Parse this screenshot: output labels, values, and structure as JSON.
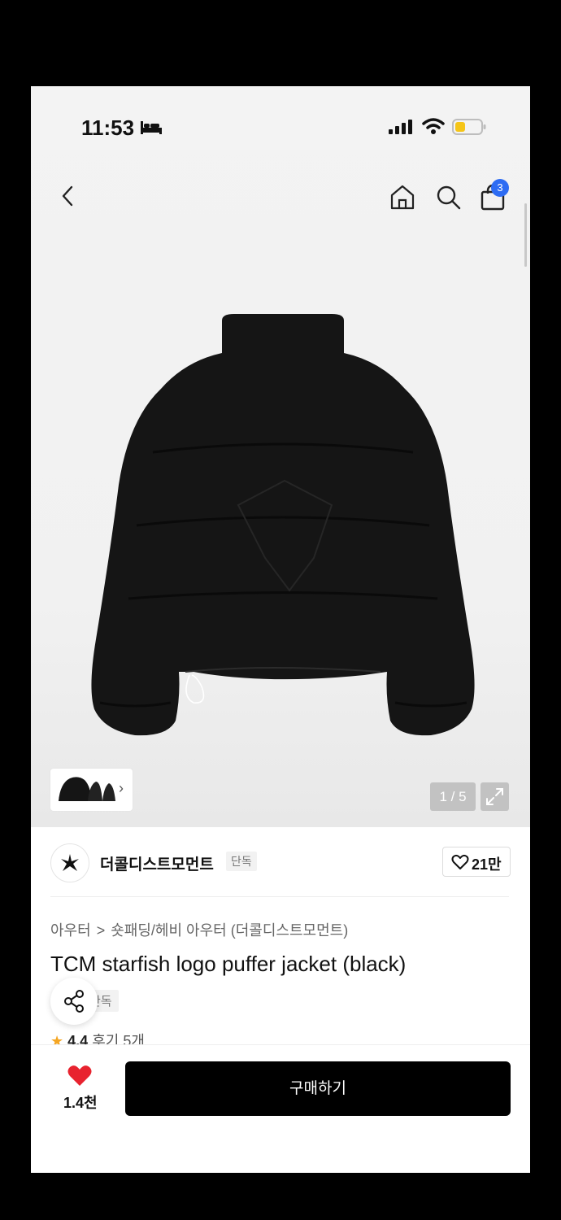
{
  "status_bar": {
    "time": "11:53"
  },
  "header": {
    "cart_count": "3"
  },
  "gallery": {
    "page_indicator": "1 / 5"
  },
  "brand": {
    "name": "더콜디스트모먼트",
    "badge": "단독",
    "likes": "21만"
  },
  "breadcrumb": {
    "category": "아우터",
    "separator": ">",
    "subcategory": "숏패딩/헤비 아우터 (더콜디스트모먼트)"
  },
  "product": {
    "title": "TCM starfish logo puffer jacket (black)",
    "tag": "단독",
    "rating": "4.4",
    "reviews": "후기 5개"
  },
  "bottom_bar": {
    "wish_count": "1.4천",
    "buy_label": "구매하기"
  },
  "icons": {
    "back": "chevron-left-icon",
    "home": "home-icon",
    "search": "search-icon",
    "cart": "shopping-bag-icon",
    "share": "share-icon",
    "like": "heart-outline-icon",
    "wish": "heart-filled-icon"
  },
  "colors": {
    "accent": "#2d6cf3",
    "wish_heart": "#e8232f",
    "star": "#f5a623",
    "buy_button": "#000000"
  }
}
